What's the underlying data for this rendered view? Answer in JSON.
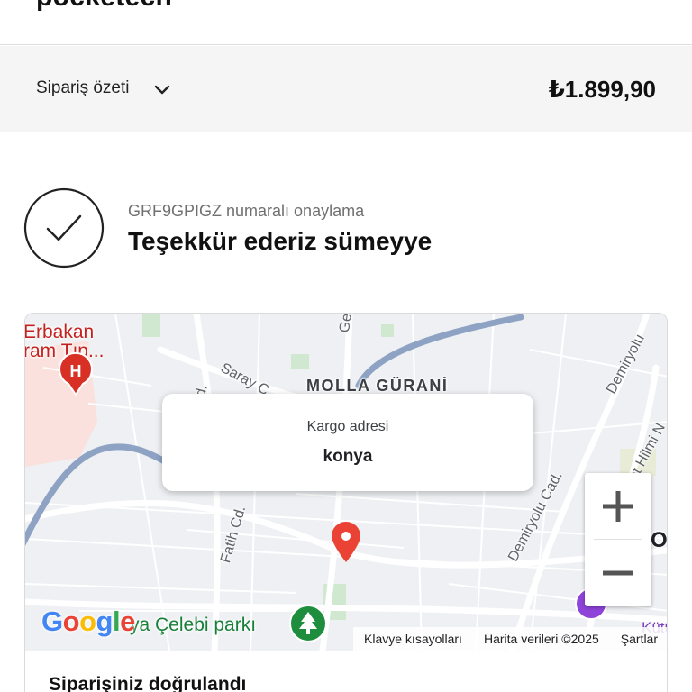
{
  "header": {
    "store_name": "pocketech"
  },
  "order_summary": {
    "label": "Sipariş özeti",
    "total": "₺1.899,90",
    "toggle_icon": "chevron-down-icon"
  },
  "confirmation": {
    "number_line": "GRF9GPIGZ numaralı onaylama",
    "thanks": "Teşekkür ederiz sümeyye",
    "icon": "check-circle-icon"
  },
  "map": {
    "labels": {
      "district": "MOLLA GÜRANİ",
      "hospital": "Erbakan\nram Tıp...",
      "street_gench": "Gençl",
      "street_saray": "Saray C",
      "street_d": "d.",
      "street_fatih": "Fatih Cd.",
      "street_demiryolu_cad": "Demiryolu Cad.",
      "street_demiryolu": "Demiryolu",
      "street_hilmi": "ımet Hilmi N",
      "park": "ya Çelebi parkı",
      "partial_place": "OI",
      "partial_purple": "Kütü"
    },
    "popup": {
      "title": "Kargo adresi",
      "value": "konya"
    },
    "zoom_in_label": "+",
    "zoom_out_label": "−",
    "google_logo": [
      "G",
      "o",
      "o",
      "g",
      "l",
      "e"
    ],
    "google_colors": [
      "#4285F4",
      "#EA4335",
      "#FBBC05",
      "#4285F4",
      "#34A853",
      "#EA4335"
    ],
    "footer": {
      "shortcuts": "Klavye kısayolları",
      "data": "Harita verileri ©2025",
      "terms": "Şartlar"
    },
    "colors": {
      "pin": "#EA4335",
      "hospital": "#D93025",
      "park": "#1E8E3E",
      "road": "#ffffff",
      "highway": "#8ea2c4"
    }
  },
  "order_card": {
    "heading": "Siparişiniz doğrulandı"
  }
}
